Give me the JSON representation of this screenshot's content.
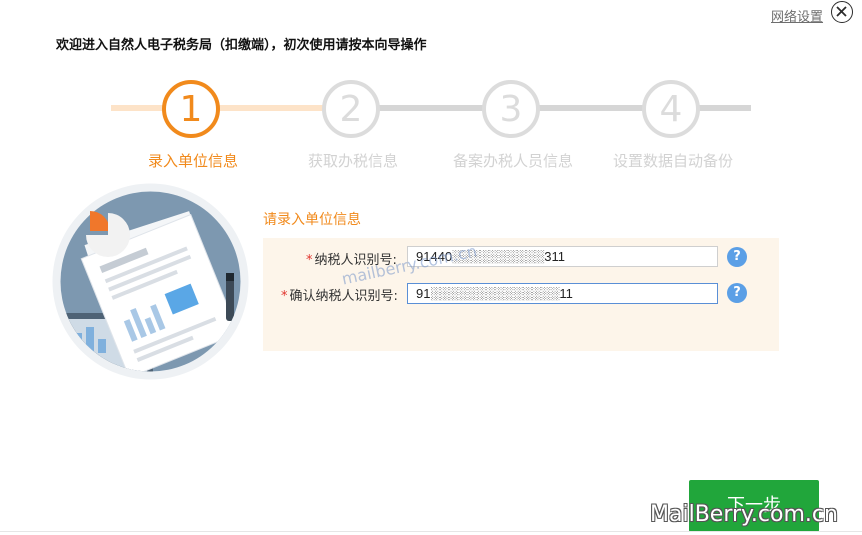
{
  "header": {
    "network_settings_label": "网络设置",
    "welcome_text": "欢迎进入自然人电子税务局（扣缴端），初次使用请按本向导操作"
  },
  "steps": [
    {
      "number": "1",
      "label": "录入单位信息",
      "active": true
    },
    {
      "number": "2",
      "label": "获取办税信息",
      "active": false
    },
    {
      "number": "3",
      "label": "备案办税人员信息",
      "active": false
    },
    {
      "number": "4",
      "label": "设置数据自动备份",
      "active": false
    }
  ],
  "form": {
    "section_title": "请录入单位信息",
    "taxpayer_id": {
      "required_mark": "*",
      "label": "纳税人识别号:",
      "value": "91440░░░░░░░░░░311"
    },
    "confirm_taxpayer_id": {
      "required_mark": "*",
      "label": "确认纳税人识别号:",
      "value": "91░░░░░░░░░░░░░░11"
    },
    "help_symbol": "?"
  },
  "footer": {
    "next_label": "下一步"
  },
  "watermark": {
    "main": "MailBerry.com.cn",
    "faint": "mailberry.com.cn"
  },
  "colors": {
    "accent": "#f18a1c",
    "inactive_step": "#dcdcdc",
    "panel_bg": "#fdf5ea",
    "next_button": "#21a63b",
    "help_icon": "#5b9fe6"
  }
}
